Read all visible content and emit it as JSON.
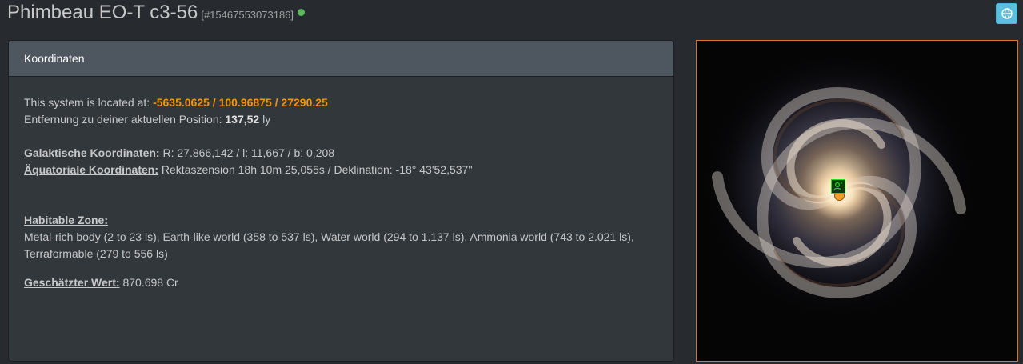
{
  "header": {
    "system_name": "Phimbeau EO-T c3-56",
    "system_id": "[#15467553073186]",
    "status": "online",
    "globe_button_icon": "globe-icon"
  },
  "panel": {
    "heading": "Koordinaten",
    "located_prefix": "This system is located at:",
    "coordinates": "-5635.0625 / 100.96875 / 27290.25",
    "distance_label": "Entfernung zu deiner aktuellen Position:",
    "distance_value": "137,52",
    "distance_unit": "ly",
    "galactic_label": "Galaktische Koordinaten:",
    "galactic_value": "R: 27.866,142 / l: 11,667 / b: 0,208",
    "equatorial_label": "Äquatoriale Koordinaten:",
    "equatorial_value": "Rektaszension 18h 10m 25,055s / Deklination: -18° 43'52,537''",
    "habitable_label": "Habitable Zone:",
    "habitable_line1": "Metal-rich body (2 to 23 ls), Earth-like world (358 to 537 ls), Water world (294 to 1.137 ls), Ammonia world (743 to 2.021 ls),",
    "habitable_line2": "Terraformable (279 to 556 ls)",
    "value_label": "Geschätzter Wert:",
    "value_amount": "870.698 Cr"
  },
  "map": {
    "type": "galaxy-map",
    "marker_icon": "commander-position-icon",
    "accent_border": "#d9742b"
  },
  "colors": {
    "accent_orange": "#f89406",
    "online_green": "#5cb85c",
    "globe_button": "#5bc0de"
  }
}
